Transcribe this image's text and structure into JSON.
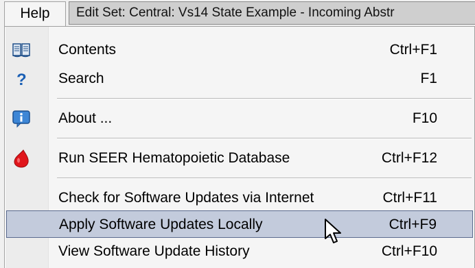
{
  "menubar": {
    "help_label": "Help",
    "window_title": "Edit Set: Central: Vs14 State Example - Incoming Abstr"
  },
  "menu": {
    "items": [
      {
        "label": "Contents",
        "shortcut": "Ctrl+F1",
        "icon": "book-icon"
      },
      {
        "label": "Search",
        "shortcut": "F1",
        "icon": "question-mark-icon"
      },
      {
        "label": "About ...",
        "shortcut": "F10",
        "icon": "info-icon"
      },
      {
        "label": "Run SEER Hematopoietic Database",
        "shortcut": "Ctrl+F12",
        "icon": "blood-drop-icon"
      },
      {
        "label": "Check for Software Updates via Internet",
        "shortcut": "Ctrl+F11",
        "icon": ""
      },
      {
        "label": "Apply Software Updates Locally",
        "shortcut": "Ctrl+F9",
        "icon": ""
      },
      {
        "label": "View Software Update History",
        "shortcut": "Ctrl+F10",
        "icon": ""
      }
    ],
    "highlighted_item": "Apply Software Updates Locally"
  },
  "colors": {
    "highlight_fill": "#c3cbdc",
    "highlight_border": "#5a6a8e",
    "blood_drop": "#e0151b",
    "help_icon_blue": "#1a5fb4"
  }
}
